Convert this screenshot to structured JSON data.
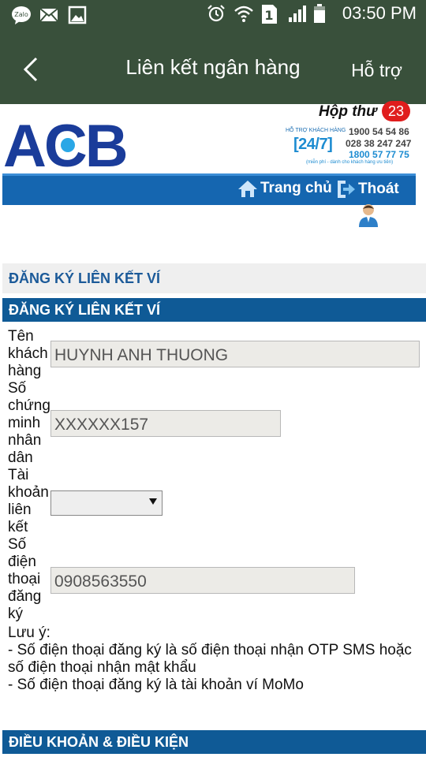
{
  "statusbar": {
    "time": "03:50 PM",
    "signal_badge": "1",
    "zalo_label": "Zalo"
  },
  "actionbar": {
    "title": "Liên kết ngân hàng",
    "help": "Hỗ trợ"
  },
  "header": {
    "logo_text": "ACB",
    "inbox_label": "Hộp thư",
    "inbox_count": "23",
    "support": {
      "label": "HỖ TRỢ KHÁCH HÀNG",
      "badge": "[24/7]",
      "phone1": "1900 54 54 86",
      "phone2": "028 38 247 247",
      "phone3": "1800 57 77 75",
      "note": "(miễn phí - dành cho khách hàng ưu tiên)"
    },
    "nav": {
      "home": "Trang chủ",
      "logout": "Thoát"
    }
  },
  "sections": {
    "title_light": "ĐĂNG KÝ LIÊN KẾT VÍ",
    "title_dark": "ĐĂNG KÝ LIÊN KẾT VÍ",
    "terms": "ĐIỀU KHOẢN & ĐIỀU KIỆN"
  },
  "form": {
    "customer_name_label": "Tên khách hàng",
    "customer_name_value": "HUYNH ANH THUONG",
    "id_label": "Số chứng minh nhân dân",
    "id_value": "XXXXXX157",
    "account_label": "Tài khoản liên kết",
    "account_value": "",
    "phone_label": "Số điện thoại đăng ký",
    "phone_value": "0908563550"
  },
  "notes": {
    "heading": "Lưu ý:",
    "line1": "- Số điện thoại đăng ký là số điện thoại nhận OTP SMS hoặc số điện thoại nhận mật khẩu",
    "line2": "- Số điện thoại đăng ký là tài khoản ví MoMo"
  },
  "colors": {
    "app_bar": "#39503b",
    "acb_blue": "#1566b0",
    "section_dark": "#0f5a96",
    "badge_red": "#e01d1d"
  }
}
